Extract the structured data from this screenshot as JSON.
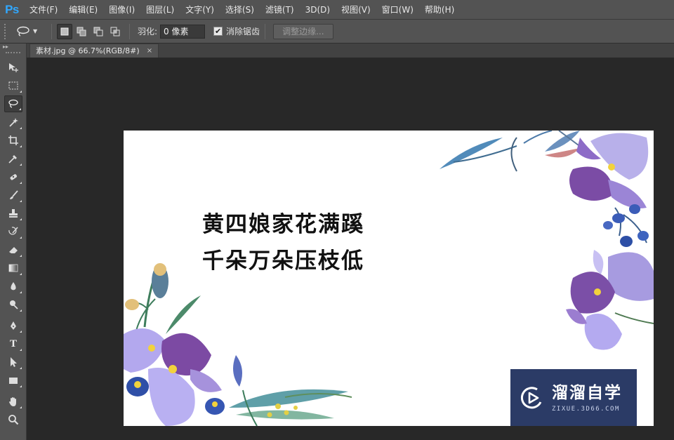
{
  "app": {
    "logo": "Ps"
  },
  "menu": [
    "文件(F)",
    "编辑(E)",
    "图像(I)",
    "图层(L)",
    "文字(Y)",
    "选择(S)",
    "滤镜(T)",
    "3D(D)",
    "视图(V)",
    "窗口(W)",
    "帮助(H)"
  ],
  "options": {
    "feather_label": "羽化:",
    "feather_value": "0 像素",
    "antialias_label": "消除锯齿",
    "antialias_checked": true,
    "refine_edge_label": "调整边缘..."
  },
  "document": {
    "tab_title": "素材.jpg @ 66.7%(RGB/8#)",
    "close_glyph": "×"
  },
  "canvas": {
    "line1": "黄四娘家花满蹊",
    "line2": "千朵万朵压枝低"
  },
  "watermark": {
    "title": "溜溜自学",
    "subtitle": "ZIXUE.3D66.COM"
  },
  "tools": [
    "move-tool",
    "marquee-tool",
    "lasso-tool",
    "magic-wand-tool",
    "crop-tool",
    "eyedropper-tool",
    "healing-brush-tool",
    "brush-tool",
    "clone-stamp-tool",
    "history-brush-tool",
    "eraser-tool",
    "gradient-tool",
    "blur-tool",
    "dodge-tool",
    "pen-tool",
    "type-tool",
    "path-selection-tool",
    "rectangle-tool",
    "hand-tool",
    "zoom-tool"
  ],
  "colors": {
    "accent": "#31a8ff",
    "watermark_bg": "#2b3b66",
    "flower_purple": "#8c7bd6"
  }
}
